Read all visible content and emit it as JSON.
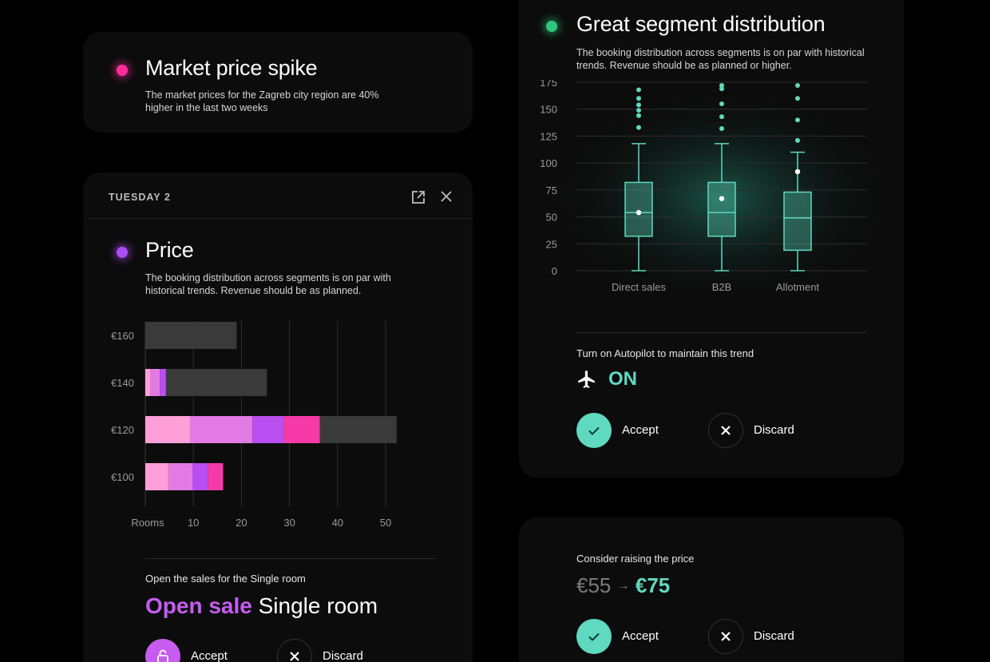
{
  "market_card": {
    "title": "Market price spike",
    "description": "The market prices for the Zagreb city region are 40% higher in the last two weeks"
  },
  "day_card": {
    "header": "TUESDAY 2",
    "title": "Price",
    "description": "The booking distribution across segments is on par with historical trends. Revenue should be as planned.",
    "action_caption": "Open the sales for the Single room",
    "action_highlight": "Open sale",
    "action_rest": "Single room",
    "accept_label": "Accept",
    "discard_label": "Discard",
    "icons": [
      "external-link-icon",
      "close-icon",
      "lock-icon",
      "close-icon"
    ]
  },
  "segment_card": {
    "title": "Great segment distribution",
    "description": "The booking distribution across segments is on par with historical trends. Revenue should be as planned or higher.",
    "autopilot_caption": "Turn on Autopilot to maintain this trend",
    "autopilot_state": "ON",
    "accept_label": "Accept",
    "discard_label": "Discard",
    "icons": [
      "plane-icon",
      "check-icon",
      "close-icon"
    ]
  },
  "raise_card": {
    "caption": "Consider raising the price",
    "old_price": "€55",
    "arrow": "→",
    "new_price": "€75",
    "accept_label": "Accept",
    "discard_label": "Discard"
  },
  "colors": {
    "accent_teal": "#5fd9c0",
    "accent_purple": "#c65cf0",
    "pink_dot": "#ff2d9b",
    "green_dot": "#2cc77a",
    "purple_dot": "#a94df5"
  },
  "chart_data": [
    {
      "type": "bar",
      "orientation": "horizontal-stacked",
      "categories": [
        "€160",
        "€140",
        "€120",
        "€100"
      ],
      "xlabel": "Rooms",
      "xticks": [
        10,
        20,
        30,
        40,
        50
      ],
      "xlim": [
        0,
        52
      ],
      "segments": [
        {
          "category": "€160",
          "parts": [
            {
              "value": 19,
              "color": "#3a3a3a"
            }
          ]
        },
        {
          "category": "€140",
          "parts": [
            {
              "value": 1,
              "color": "#ff9fd8"
            },
            {
              "value": 2,
              "color": "#e27ae3"
            },
            {
              "value": 1.3,
              "color": "#b94ff0"
            },
            {
              "value": 21,
              "color": "#3a3a3a"
            }
          ]
        },
        {
          "category": "€120",
          "parts": [
            {
              "value": 9.3,
              "color": "#ff9fd8"
            },
            {
              "value": 13,
              "color": "#e27ae3"
            },
            {
              "value": 6.5,
              "color": "#b94ff0"
            },
            {
              "value": 7.5,
              "color": "#f53aa8"
            },
            {
              "value": 16,
              "color": "#3a3a3a"
            }
          ]
        },
        {
          "category": "€100",
          "parts": [
            {
              "value": 4.8,
              "color": "#ff9fd8"
            },
            {
              "value": 5,
              "color": "#e27ae3"
            },
            {
              "value": 3.2,
              "color": "#b94ff0"
            },
            {
              "value": 3.2,
              "color": "#f53aa8"
            }
          ]
        }
      ]
    },
    {
      "type": "box",
      "categories": [
        "Direct sales",
        "B2B",
        "Allotment"
      ],
      "yticks": [
        0,
        25,
        50,
        75,
        100,
        125,
        150,
        175
      ],
      "ylim": [
        0,
        175
      ],
      "boxes": [
        {
          "name": "Direct sales",
          "min": 0,
          "q1": 32,
          "median": 54,
          "q3": 82,
          "max": 118,
          "mean": 54,
          "outliers": [
            133,
            144,
            149,
            154,
            160,
            168
          ]
        },
        {
          "name": "B2B",
          "min": 0,
          "q1": 32,
          "median": 54,
          "q3": 82,
          "max": 118,
          "mean": 67,
          "outliers": [
            132,
            143,
            155,
            169,
            172
          ]
        },
        {
          "name": "Allotment",
          "min": 0,
          "q1": 19,
          "median": 49,
          "q3": 73,
          "max": 110,
          "mean": 92,
          "outliers": [
            121,
            140,
            160,
            172
          ]
        }
      ],
      "color": "#5fd9c0"
    }
  ]
}
